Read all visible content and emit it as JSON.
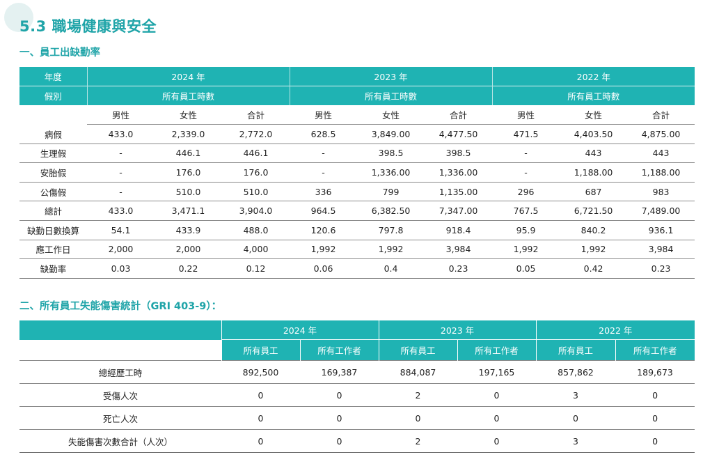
{
  "page_title": "5.3 職場健康與安全",
  "section1_title": "一、員工出缺勤率",
  "section2_title": "二、所有員工失能傷害統計（GRI 403-9）：",
  "absence": {
    "year_label": "年度",
    "type_label": "假別",
    "years": [
      "2024 年",
      "2023 年",
      "2022 年"
    ],
    "group_label": "所有員工時數",
    "sub_headers": [
      "男性",
      "女性",
      "合計",
      "男性",
      "女性",
      "合計",
      "男性",
      "女性",
      "合計"
    ],
    "rows": [
      {
        "label": "病假",
        "values": [
          "433.0",
          "2,339.0",
          "2,772.0",
          "628.5",
          "3,849.00",
          "4,477.50",
          "471.5",
          "4,403.50",
          "4,875.00"
        ]
      },
      {
        "label": "生理假",
        "values": [
          "-",
          "446.1",
          "446.1",
          "-",
          "398.5",
          "398.5",
          "-",
          "443",
          "443"
        ]
      },
      {
        "label": "安胎假",
        "values": [
          "-",
          "176.0",
          "176.0",
          "-",
          "1,336.00",
          "1,336.00",
          "-",
          "1,188.00",
          "1,188.00"
        ]
      },
      {
        "label": "公傷假",
        "values": [
          "-",
          "510.0",
          "510.0",
          "336",
          "799",
          "1,135.00",
          "296",
          "687",
          "983"
        ]
      },
      {
        "label": "總計",
        "values": [
          "433.0",
          "3,471.1",
          "3,904.0",
          "964.5",
          "6,382.50",
          "7,347.00",
          "767.5",
          "6,721.50",
          "7,489.00"
        ]
      },
      {
        "label": "缺勤日數換算",
        "values": [
          "54.1",
          "433.9",
          "488.0",
          "120.6",
          "797.8",
          "918.4",
          "95.9",
          "840.2",
          "936.1"
        ]
      },
      {
        "label": "應工作日",
        "values": [
          "2,000",
          "2,000",
          "4,000",
          "1,992",
          "1,992",
          "3,984",
          "1,992",
          "1,992",
          "3,984"
        ]
      },
      {
        "label": "缺勤率",
        "values": [
          "0.03",
          "0.22",
          "0.12",
          "0.06",
          "0.4",
          "0.23",
          "0.05",
          "0.42",
          "0.23"
        ]
      }
    ]
  },
  "injury": {
    "years": [
      "2024 年",
      "2023 年",
      "2022 年"
    ],
    "sub_headers": [
      "所有員工",
      "所有工作者",
      "所有員工",
      "所有工作者",
      "所有員工",
      "所有工作者"
    ],
    "rows": [
      {
        "label": "總經歷工時",
        "values": [
          "892,500",
          "169,387",
          "884,087",
          "197,165",
          "857,862",
          "189,673"
        ]
      },
      {
        "label": "受傷人次",
        "values": [
          "0",
          "0",
          "2",
          "0",
          "3",
          "0"
        ]
      },
      {
        "label": "死亡人次",
        "values": [
          "0",
          "0",
          "0",
          "0",
          "0",
          "0"
        ]
      },
      {
        "label": "失能傷害次數合計（人次）",
        "values": [
          "0",
          "0",
          "2",
          "0",
          "3",
          "0"
        ]
      }
    ]
  }
}
